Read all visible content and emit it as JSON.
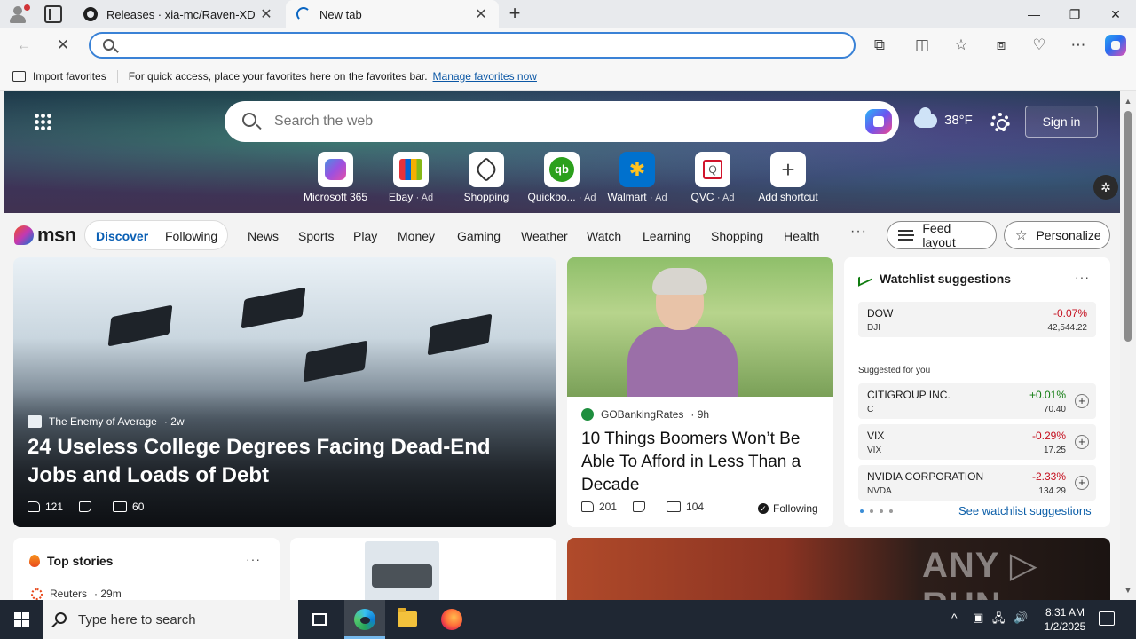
{
  "browser": {
    "tabs": [
      {
        "title": "Releases · xia-mc/Raven-XD",
        "icon": "github-icon"
      },
      {
        "title": "New tab",
        "icon": "loading-spinner-icon"
      }
    ],
    "address": {
      "value": "",
      "placeholder": ""
    },
    "favorites_bar": {
      "import_label": "Import favorites",
      "message": "For quick access, place your favorites here on the favorites bar.",
      "link": "Manage favorites now"
    },
    "window_controls": {
      "minimize": "—",
      "restore": "❐",
      "close": "✕"
    }
  },
  "newtab": {
    "search": {
      "placeholder": "Search the web"
    },
    "weather": {
      "temp": "38°F",
      "icon": "cloudy-icon"
    },
    "sign_in": "Sign in",
    "shortcuts": [
      {
        "label": "Microsoft 365",
        "ad": ""
      },
      {
        "label": "Ebay",
        "ad": "· Ad"
      },
      {
        "label": "Shopping",
        "ad": ""
      },
      {
        "label": "Quickbo...",
        "ad": "· Ad"
      },
      {
        "label": "Walmart",
        "ad": "· Ad"
      },
      {
        "label": "QVC",
        "ad": "· Ad"
      },
      {
        "label": "Add shortcut",
        "ad": ""
      }
    ],
    "qb_logo": "qb",
    "walmart_logo": "✱",
    "qvc_logo": "Q"
  },
  "msn": {
    "logo": "msn",
    "toggle": {
      "discover": "Discover",
      "following": "Following"
    },
    "categories": [
      "News",
      "Sports",
      "Play",
      "Money",
      "Gaming",
      "Weather",
      "Watch",
      "Learning",
      "Shopping",
      "Health"
    ],
    "more": "···",
    "feed_layout": "Feed layout",
    "personalize": "Personalize"
  },
  "hero": {
    "source": "The Enemy of Average",
    "age": "· 2w",
    "title": "24 Useless College Degrees Facing Dead-End Jobs and Loads of Debt",
    "likes": "121",
    "comments": "60"
  },
  "news": {
    "source": "GOBankingRates",
    "age": "· 9h",
    "title": "10 Things Boomers Won’t Be Able To Afford in Less Than a Decade",
    "likes": "201",
    "comments": "104",
    "following": "Following"
  },
  "watchlist": {
    "title": "Watchlist suggestions",
    "more": "···",
    "index": {
      "name": "DOW",
      "ticker": "DJI",
      "change": "-0.07%",
      "price": "42,544.22"
    },
    "suggested_label": "Suggested for you",
    "suggestions": [
      {
        "name": "CITIGROUP INC.",
        "ticker": "C",
        "change": "+0.01%",
        "price": "70.40"
      },
      {
        "name": "VIX",
        "ticker": "VIX",
        "change": "-0.29%",
        "price": "17.25"
      },
      {
        "name": "NVIDIA CORPORATION",
        "ticker": "NVDA",
        "change": "-2.33%",
        "price": "134.29"
      }
    ],
    "link": "See watchlist suggestions",
    "colors": {
      "up": "#107c10",
      "down": "#c50f1f"
    }
  },
  "top_stories": {
    "title": "Top stories",
    "more": "···",
    "source": "Reuters",
    "age": "· 29m"
  },
  "watermark": "ANY ▷ RUN",
  "taskbar": {
    "search_placeholder": "Type here to search",
    "time": "8:31 AM",
    "date": "1/2/2025",
    "tray": {
      "chevron": "^",
      "network": "🖧",
      "volume": "🔊"
    }
  }
}
